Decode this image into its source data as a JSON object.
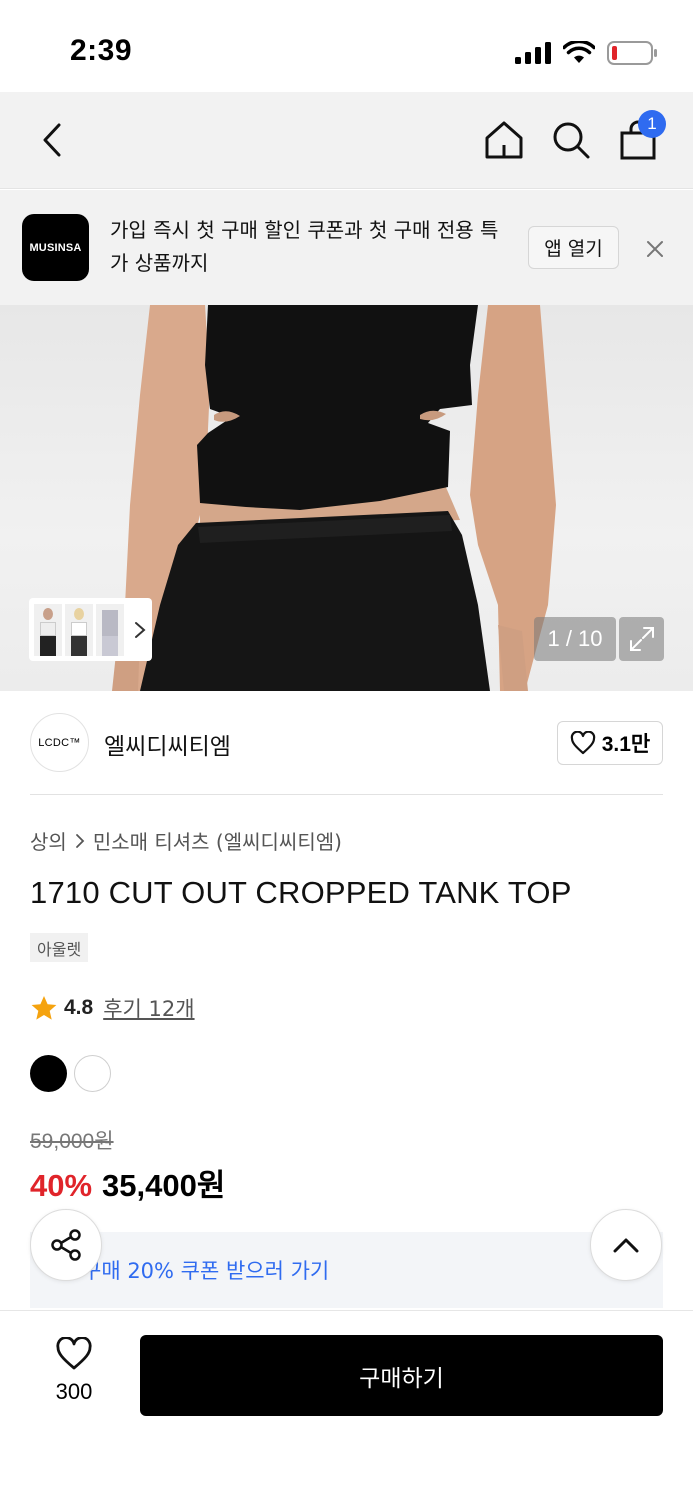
{
  "status_bar": {
    "time": "2:39"
  },
  "header": {
    "cart_count": "1"
  },
  "app_banner": {
    "logo_text": "MUSINSA",
    "message": "가입 즉시 첫 구매 할인 쿠폰과 첫 구매 전용 특가 상품까지",
    "open_app_label": "앱 열기"
  },
  "gallery": {
    "counter": "1 / 10"
  },
  "brand": {
    "logo_text": "LCDC™",
    "name": "엘씨디씨티엠",
    "likes": "3.1만"
  },
  "breadcrumb": {
    "category": "상의",
    "subcategory": "민소매 티셔츠 (엘씨디씨티엠)"
  },
  "product": {
    "title": "1710 CUT OUT CROPPED TANK TOP",
    "tag": "아울렛",
    "rating": "4.8",
    "review_label": "후기 12개",
    "colors": [
      "#000000",
      "#ffffff"
    ],
    "original_price": "59,000원",
    "discount": "40%",
    "price": "35,400원"
  },
  "coupon": {
    "label": "구매 20% 쿠폰 받으러 가기"
  },
  "bottom_bar": {
    "wish_count": "300",
    "buy_label": "구매하기"
  },
  "theme": {
    "accent": "#2f6bf0",
    "sale": "#e0242a"
  }
}
